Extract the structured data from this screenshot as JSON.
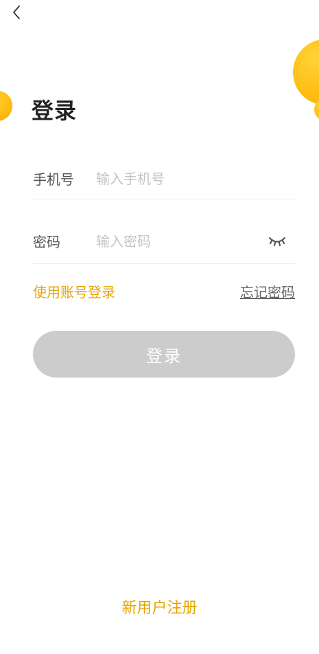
{
  "nav": {
    "back_icon": "chevron-left-icon"
  },
  "title": "登录",
  "phone": {
    "label": "手机号",
    "placeholder": "输入手机号",
    "value": ""
  },
  "password": {
    "label": "密码",
    "placeholder": "输入密码",
    "value": "",
    "toggle_icon": "eye-closed-icon"
  },
  "links": {
    "account_login": "使用账号登录",
    "forgot_password": "忘记密码"
  },
  "login_button": {
    "label": "登录",
    "state": "disabled"
  },
  "register": {
    "label": "新用户注册"
  },
  "colors": {
    "accent": "#e8a400",
    "decoration": "#ffbe12",
    "button_disabled": "#cccccc"
  }
}
